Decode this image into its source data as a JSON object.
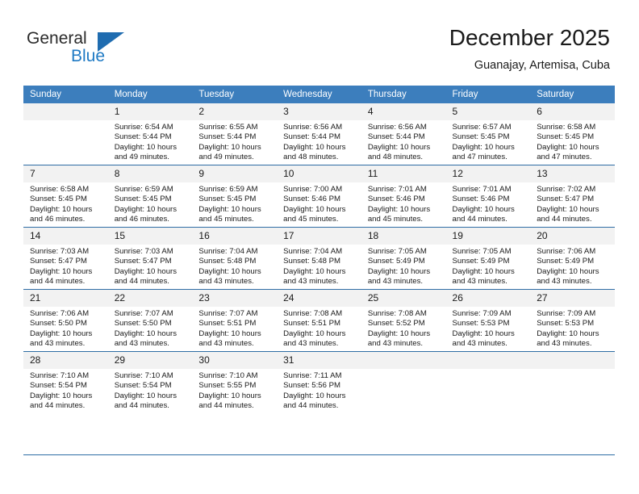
{
  "logo": {
    "word_one": "General",
    "word_two": "Blue",
    "triangle_color": "#1f6cb0",
    "blue_color": "#1f7ac4"
  },
  "header": {
    "title": "December 2025",
    "subtitle": "Guanajay, Artemisa, Cuba",
    "header_bg": "#3c7ebd",
    "daynum_bg": "#f2f2f2"
  },
  "calendar": {
    "weekday_headers": [
      "Sunday",
      "Monday",
      "Tuesday",
      "Wednesday",
      "Thursday",
      "Friday",
      "Saturday"
    ],
    "weeks": [
      [
        {
          "day": "",
          "empty": true,
          "lines": []
        },
        {
          "day": "1",
          "empty": false,
          "lines": [
            "Sunrise: 6:54 AM",
            "Sunset: 5:44 PM",
            "Daylight: 10 hours",
            "and 49 minutes."
          ]
        },
        {
          "day": "2",
          "empty": false,
          "lines": [
            "Sunrise: 6:55 AM",
            "Sunset: 5:44 PM",
            "Daylight: 10 hours",
            "and 49 minutes."
          ]
        },
        {
          "day": "3",
          "empty": false,
          "lines": [
            "Sunrise: 6:56 AM",
            "Sunset: 5:44 PM",
            "Daylight: 10 hours",
            "and 48 minutes."
          ]
        },
        {
          "day": "4",
          "empty": false,
          "lines": [
            "Sunrise: 6:56 AM",
            "Sunset: 5:44 PM",
            "Daylight: 10 hours",
            "and 48 minutes."
          ]
        },
        {
          "day": "5",
          "empty": false,
          "lines": [
            "Sunrise: 6:57 AM",
            "Sunset: 5:45 PM",
            "Daylight: 10 hours",
            "and 47 minutes."
          ]
        },
        {
          "day": "6",
          "empty": false,
          "lines": [
            "Sunrise: 6:58 AM",
            "Sunset: 5:45 PM",
            "Daylight: 10 hours",
            "and 47 minutes."
          ]
        }
      ],
      [
        {
          "day": "7",
          "empty": false,
          "lines": [
            "Sunrise: 6:58 AM",
            "Sunset: 5:45 PM",
            "Daylight: 10 hours",
            "and 46 minutes."
          ]
        },
        {
          "day": "8",
          "empty": false,
          "lines": [
            "Sunrise: 6:59 AM",
            "Sunset: 5:45 PM",
            "Daylight: 10 hours",
            "and 46 minutes."
          ]
        },
        {
          "day": "9",
          "empty": false,
          "lines": [
            "Sunrise: 6:59 AM",
            "Sunset: 5:45 PM",
            "Daylight: 10 hours",
            "and 45 minutes."
          ]
        },
        {
          "day": "10",
          "empty": false,
          "lines": [
            "Sunrise: 7:00 AM",
            "Sunset: 5:46 PM",
            "Daylight: 10 hours",
            "and 45 minutes."
          ]
        },
        {
          "day": "11",
          "empty": false,
          "lines": [
            "Sunrise: 7:01 AM",
            "Sunset: 5:46 PM",
            "Daylight: 10 hours",
            "and 45 minutes."
          ]
        },
        {
          "day": "12",
          "empty": false,
          "lines": [
            "Sunrise: 7:01 AM",
            "Sunset: 5:46 PM",
            "Daylight: 10 hours",
            "and 44 minutes."
          ]
        },
        {
          "day": "13",
          "empty": false,
          "lines": [
            "Sunrise: 7:02 AM",
            "Sunset: 5:47 PM",
            "Daylight: 10 hours",
            "and 44 minutes."
          ]
        }
      ],
      [
        {
          "day": "14",
          "empty": false,
          "lines": [
            "Sunrise: 7:03 AM",
            "Sunset: 5:47 PM",
            "Daylight: 10 hours",
            "and 44 minutes."
          ]
        },
        {
          "day": "15",
          "empty": false,
          "lines": [
            "Sunrise: 7:03 AM",
            "Sunset: 5:47 PM",
            "Daylight: 10 hours",
            "and 44 minutes."
          ]
        },
        {
          "day": "16",
          "empty": false,
          "lines": [
            "Sunrise: 7:04 AM",
            "Sunset: 5:48 PM",
            "Daylight: 10 hours",
            "and 43 minutes."
          ]
        },
        {
          "day": "17",
          "empty": false,
          "lines": [
            "Sunrise: 7:04 AM",
            "Sunset: 5:48 PM",
            "Daylight: 10 hours",
            "and 43 minutes."
          ]
        },
        {
          "day": "18",
          "empty": false,
          "lines": [
            "Sunrise: 7:05 AM",
            "Sunset: 5:49 PM",
            "Daylight: 10 hours",
            "and 43 minutes."
          ]
        },
        {
          "day": "19",
          "empty": false,
          "lines": [
            "Sunrise: 7:05 AM",
            "Sunset: 5:49 PM",
            "Daylight: 10 hours",
            "and 43 minutes."
          ]
        },
        {
          "day": "20",
          "empty": false,
          "lines": [
            "Sunrise: 7:06 AM",
            "Sunset: 5:49 PM",
            "Daylight: 10 hours",
            "and 43 minutes."
          ]
        }
      ],
      [
        {
          "day": "21",
          "empty": false,
          "lines": [
            "Sunrise: 7:06 AM",
            "Sunset: 5:50 PM",
            "Daylight: 10 hours",
            "and 43 minutes."
          ]
        },
        {
          "day": "22",
          "empty": false,
          "lines": [
            "Sunrise: 7:07 AM",
            "Sunset: 5:50 PM",
            "Daylight: 10 hours",
            "and 43 minutes."
          ]
        },
        {
          "day": "23",
          "empty": false,
          "lines": [
            "Sunrise: 7:07 AM",
            "Sunset: 5:51 PM",
            "Daylight: 10 hours",
            "and 43 minutes."
          ]
        },
        {
          "day": "24",
          "empty": false,
          "lines": [
            "Sunrise: 7:08 AM",
            "Sunset: 5:51 PM",
            "Daylight: 10 hours",
            "and 43 minutes."
          ]
        },
        {
          "day": "25",
          "empty": false,
          "lines": [
            "Sunrise: 7:08 AM",
            "Sunset: 5:52 PM",
            "Daylight: 10 hours",
            "and 43 minutes."
          ]
        },
        {
          "day": "26",
          "empty": false,
          "lines": [
            "Sunrise: 7:09 AM",
            "Sunset: 5:53 PM",
            "Daylight: 10 hours",
            "and 43 minutes."
          ]
        },
        {
          "day": "27",
          "empty": false,
          "lines": [
            "Sunrise: 7:09 AM",
            "Sunset: 5:53 PM",
            "Daylight: 10 hours",
            "and 43 minutes."
          ]
        }
      ],
      [
        {
          "day": "28",
          "empty": false,
          "lines": [
            "Sunrise: 7:10 AM",
            "Sunset: 5:54 PM",
            "Daylight: 10 hours",
            "and 44 minutes."
          ]
        },
        {
          "day": "29",
          "empty": false,
          "lines": [
            "Sunrise: 7:10 AM",
            "Sunset: 5:54 PM",
            "Daylight: 10 hours",
            "and 44 minutes."
          ]
        },
        {
          "day": "30",
          "empty": false,
          "lines": [
            "Sunrise: 7:10 AM",
            "Sunset: 5:55 PM",
            "Daylight: 10 hours",
            "and 44 minutes."
          ]
        },
        {
          "day": "31",
          "empty": false,
          "lines": [
            "Sunrise: 7:11 AM",
            "Sunset: 5:56 PM",
            "Daylight: 10 hours",
            "and 44 minutes."
          ]
        },
        {
          "day": "",
          "empty": true,
          "lines": []
        },
        {
          "day": "",
          "empty": true,
          "lines": []
        },
        {
          "day": "",
          "empty": true,
          "lines": []
        }
      ]
    ]
  }
}
